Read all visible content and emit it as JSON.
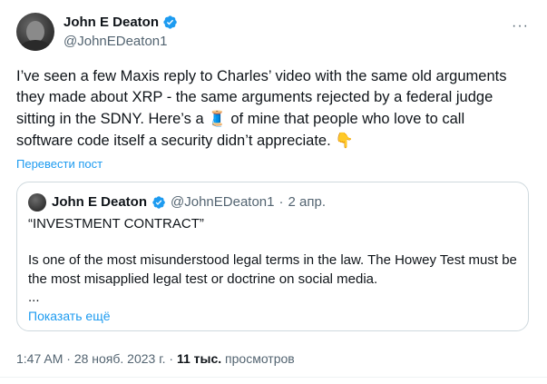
{
  "author": {
    "name": "John E Deaton",
    "handle": "@JohnEDeaton1"
  },
  "more_icon": "···",
  "tweet": {
    "text_part1": "I’ve seen a few Maxis reply to Charles’ video with the same old arguments they made about XRP - the same arguments rejected by a federal judge sitting in the SDNY.  Here’s a ",
    "thread_emoji": "🧵",
    "text_part2": " of mine that people who love to call software code itself a security didn’t appreciate. ",
    "point_emoji": "👇",
    "translate_label": "Перевести пост"
  },
  "quote": {
    "name": "John E Deaton",
    "handle": "@JohnEDeaton1",
    "separator": "·",
    "date": "2 апр.",
    "line1": "“INVESTMENT CONTRACT”",
    "body": "Is one of the most misunderstood legal terms in the law. The Howey Test must be the most misapplied legal test or doctrine on social media.",
    "ellipsis": "...",
    "show_more_label": "Показать ещё"
  },
  "footer": {
    "time": "1:47 AM",
    "sep1": " · ",
    "date": "28 нояб. 2023 г.",
    "sep2": " · ",
    "views_count": "11 тыс.",
    "views_label": " просмотров"
  },
  "colors": {
    "verified_blue": "#1d9bf0",
    "link_blue": "#1d9bf0",
    "muted": "#536471",
    "text": "#0f1419",
    "border": "#cfd9de"
  }
}
